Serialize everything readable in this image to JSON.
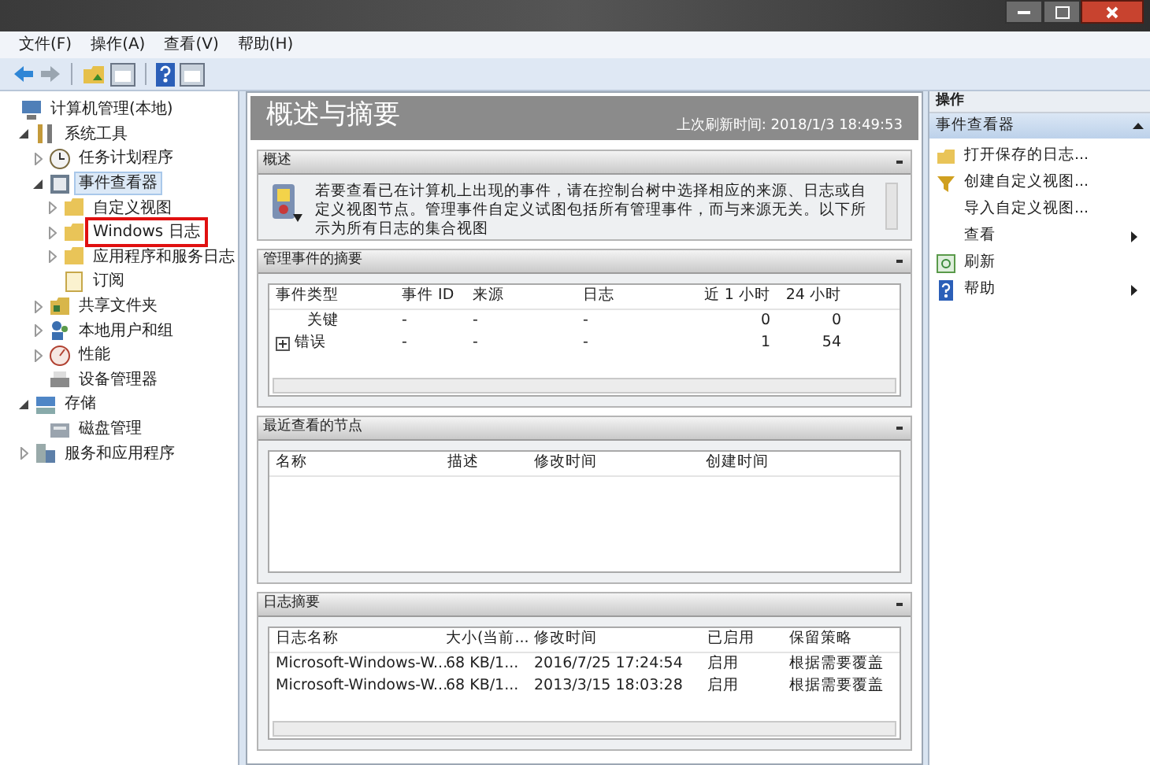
{
  "menu": [
    "文件(F)",
    "操作(A)",
    "查看(V)",
    "帮助(H)"
  ],
  "tree": [
    {
      "label": "计算机管理(本地)",
      "selected": false,
      "children": [
        {
          "label": "系统工具",
          "expanded": true,
          "selected": false,
          "children": [
            {
              "label": "任务计划程序",
              "expanded": false,
              "selected": false
            },
            {
              "label": "事件查看器",
              "expanded": true,
              "selected": true,
              "children": [
                {
                  "label": "自定义视图",
                  "expanded": false,
                  "selected": false
                },
                {
                  "label": "Windows 日志",
                  "expanded": false,
                  "selected": false,
                  "highlighted": true
                },
                {
                  "label": "应用程序和服务日志",
                  "expanded": false,
                  "selected": false
                },
                {
                  "label": "订阅",
                  "selected": false
                }
              ]
            },
            {
              "label": "共享文件夹",
              "expanded": false,
              "selected": false
            },
            {
              "label": "本地用户和组",
              "expanded": false,
              "selected": false
            },
            {
              "label": "性能",
              "expanded": false,
              "selected": false
            },
            {
              "label": "设备管理器",
              "selected": false
            }
          ]
        },
        {
          "label": "存储",
          "expanded": true,
          "selected": false,
          "children": [
            {
              "label": "磁盘管理",
              "selected": false
            }
          ]
        },
        {
          "label": "服务和应用程序",
          "expanded": false,
          "selected": false
        }
      ]
    }
  ],
  "main": {
    "title": "概述与摘要",
    "refresh": "上次刷新时间: 2018/1/3 18:49:53",
    "sections": [
      {
        "kind": "text",
        "title": "概述",
        "text": "若要查看已在计算机上出现的事件，请在控制台树中选择相应的来源、日志或自定义视图节点。管理事件自定义试图包括所有管理事件，而与来源无关。以下所示为所有日志的集合视图"
      },
      {
        "kind": "table",
        "title": "管理事件的摘要",
        "columns": [
          "事件类型",
          "事件 ID",
          "来源",
          "日志",
          "近 1 小时",
          "24 小时"
        ],
        "rows": [
          {
            "expandable": false,
            "cells": [
              "关键",
              "-",
              "-",
              "-",
              "0",
              "0"
            ]
          },
          {
            "expandable": true,
            "cells": [
              "错误",
              "-",
              "-",
              "-",
              "1",
              "54"
            ]
          }
        ]
      },
      {
        "kind": "table",
        "title": "最近查看的节点",
        "columns": [
          "名称",
          "描述",
          "修改时间",
          "创建时间"
        ]
      },
      {
        "kind": "table",
        "title": "日志摘要",
        "columns": [
          "日志名称",
          "大小(当前...",
          "修改时间",
          "已启用",
          "保留策略"
        ],
        "rows": [
          {
            "cells": [
              "Microsoft-Windows-W...",
              "68 KB/1...",
              "2016/7/25 17:24:54",
              "启用",
              "根据需要覆盖"
            ]
          },
          {
            "cells": [
              "Microsoft-Windows-W...",
              "68 KB/1...",
              "2013/3/15 18:03:28",
              "启用",
              "根据需要覆盖"
            ]
          }
        ]
      }
    ]
  },
  "actions": {
    "title": "操作",
    "group": "事件查看器",
    "items": [
      {
        "label": "打开保存的日志...",
        "submenu": false
      },
      {
        "label": "创建自定义视图...",
        "submenu": false
      },
      {
        "label": "导入自定义视图...",
        "submenu": false
      },
      {
        "label": "查看",
        "submenu": true
      },
      {
        "label": "刷新",
        "submenu": false
      },
      {
        "label": "帮助",
        "submenu": true
      }
    ]
  }
}
